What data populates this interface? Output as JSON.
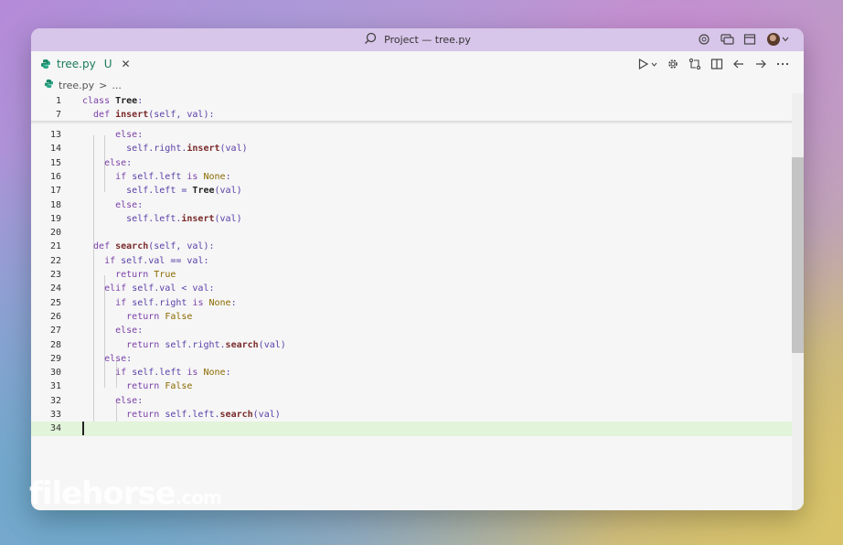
{
  "window": {
    "title": "Project — tree.py"
  },
  "tab": {
    "label": "tree.py",
    "status": "U",
    "close": "✕"
  },
  "breadcrumb": {
    "file": "tree.py",
    "sep": ">",
    "more": "..."
  },
  "watermark": {
    "main": "filehorse",
    "suffix": ".com"
  },
  "colors": {
    "titlebar": "#d8c5ea",
    "current_line": "#e2f4da",
    "tab_accent": "#1a7a5a"
  },
  "sticky": [
    {
      "n": "1",
      "tokens": [
        [
          "kw",
          "class "
        ],
        [
          "cls",
          "Tree"
        ],
        [
          "plain",
          ":"
        ]
      ]
    },
    {
      "n": "7",
      "tokens": [
        [
          "kw",
          "  def "
        ],
        [
          "fn",
          "insert"
        ],
        [
          "plain",
          "(self, val):"
        ]
      ]
    }
  ],
  "lines": [
    {
      "n": "13",
      "tokens": [
        [
          "kw",
          "      else"
        ],
        [
          "plain",
          ":"
        ]
      ]
    },
    {
      "n": "14",
      "tokens": [
        [
          "plain",
          "        self.right."
        ],
        [
          "fn",
          "insert"
        ],
        [
          "plain",
          "(val)"
        ]
      ]
    },
    {
      "n": "15",
      "tokens": [
        [
          "kw",
          "    else"
        ],
        [
          "plain",
          ":"
        ]
      ]
    },
    {
      "n": "16",
      "tokens": [
        [
          "kw",
          "      if "
        ],
        [
          "plain",
          "self.left "
        ],
        [
          "kw",
          "is "
        ],
        [
          "bool",
          "None"
        ],
        [
          "plain",
          ":"
        ]
      ]
    },
    {
      "n": "17",
      "tokens": [
        [
          "plain",
          "        self.left = "
        ],
        [
          "cls",
          "Tree"
        ],
        [
          "plain",
          "(val)"
        ]
      ]
    },
    {
      "n": "18",
      "tokens": [
        [
          "kw",
          "      else"
        ],
        [
          "plain",
          ":"
        ]
      ]
    },
    {
      "n": "19",
      "tokens": [
        [
          "plain",
          "        self.left."
        ],
        [
          "fn",
          "insert"
        ],
        [
          "plain",
          "(val)"
        ]
      ]
    },
    {
      "n": "20",
      "tokens": []
    },
    {
      "n": "21",
      "tokens": [
        [
          "kw",
          "  def "
        ],
        [
          "fn",
          "search"
        ],
        [
          "plain",
          "(self, val):"
        ]
      ]
    },
    {
      "n": "22",
      "tokens": [
        [
          "kw",
          "    if "
        ],
        [
          "plain",
          "self.val == val:"
        ]
      ]
    },
    {
      "n": "23",
      "tokens": [
        [
          "kw",
          "      return "
        ],
        [
          "bool",
          "True"
        ]
      ]
    },
    {
      "n": "24",
      "tokens": [
        [
          "kw",
          "    elif "
        ],
        [
          "plain",
          "self.val < val:"
        ]
      ]
    },
    {
      "n": "25",
      "tokens": [
        [
          "kw",
          "      if "
        ],
        [
          "plain",
          "self.right "
        ],
        [
          "kw",
          "is "
        ],
        [
          "bool",
          "None"
        ],
        [
          "plain",
          ":"
        ]
      ]
    },
    {
      "n": "26",
      "tokens": [
        [
          "kw",
          "        return "
        ],
        [
          "bool",
          "False"
        ]
      ]
    },
    {
      "n": "27",
      "tokens": [
        [
          "kw",
          "      else"
        ],
        [
          "plain",
          ":"
        ]
      ]
    },
    {
      "n": "28",
      "tokens": [
        [
          "kw",
          "        return "
        ],
        [
          "plain",
          "self.right."
        ],
        [
          "fn",
          "search"
        ],
        [
          "plain",
          "(val)"
        ]
      ]
    },
    {
      "n": "29",
      "tokens": [
        [
          "kw",
          "    else"
        ],
        [
          "plain",
          ":"
        ]
      ]
    },
    {
      "n": "30",
      "tokens": [
        [
          "kw",
          "      if "
        ],
        [
          "plain",
          "self.left "
        ],
        [
          "kw",
          "is "
        ],
        [
          "bool",
          "None"
        ],
        [
          "plain",
          ":"
        ]
      ]
    },
    {
      "n": "31",
      "tokens": [
        [
          "kw",
          "        return "
        ],
        [
          "bool",
          "False"
        ]
      ]
    },
    {
      "n": "32",
      "tokens": [
        [
          "kw",
          "      else"
        ],
        [
          "plain",
          ":"
        ]
      ]
    },
    {
      "n": "33",
      "tokens": [
        [
          "kw",
          "        return "
        ],
        [
          "plain",
          "self.left."
        ],
        [
          "fn",
          "search"
        ],
        [
          "plain",
          "(val)"
        ]
      ]
    },
    {
      "n": "34",
      "tokens": [],
      "current": true
    }
  ]
}
